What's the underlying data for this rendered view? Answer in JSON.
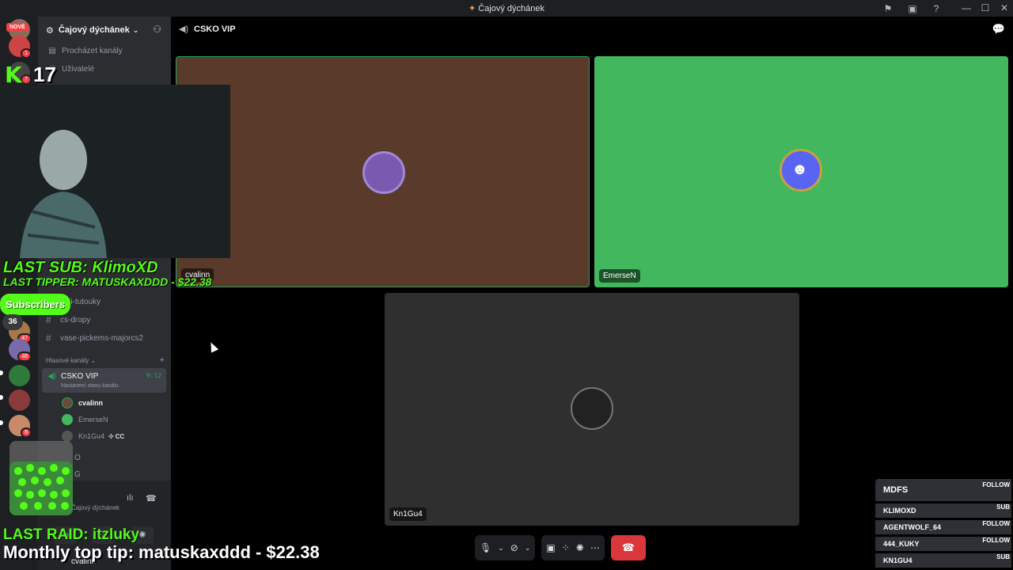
{
  "window": {
    "title": "Čajový dýchánek",
    "icons": [
      "inbox-icon",
      "screen-icon",
      "help-icon"
    ],
    "controls": [
      "—",
      "☐",
      "✕"
    ]
  },
  "rail": {
    "new_label": "NOVÉ",
    "badges": [
      "1",
      "7",
      "47",
      "48",
      "8"
    ]
  },
  "sidebar": {
    "guild_name": "Čajový dýchánek",
    "nav": [
      {
        "label": "Procházet kanály",
        "icon": "browse-icon"
      },
      {
        "label": "Uživatelé",
        "icon": "users-icon"
      }
    ],
    "channels": [
      "keti-tutouky",
      "cs-dropy",
      "vase-pickems-majorcs2"
    ],
    "voice_category": "Hlasové kanály",
    "voice_channel": {
      "name": "CSKO VIP",
      "status": "Nastavení stavu kanálu",
      "time": "9:12"
    },
    "voice_users": [
      {
        "name": "cvalinn",
        "color": "#f2f3f5"
      },
      {
        "name": "EmerseN",
        "color": "#949ba4"
      },
      {
        "name": "Kn1Gu4",
        "color": "#949ba4",
        "tag": "CC"
      }
    ],
    "partial": [
      "O",
      "G"
    ],
    "user": {
      "name": "cvalinn",
      "status": "Čajový dýchánek"
    }
  },
  "main": {
    "channel": "CSKO VIP",
    "tiles": [
      {
        "name": "cvalinn",
        "bg": "#5a3a2a"
      },
      {
        "name": "EmerseN",
        "bg": "#43b75d"
      },
      {
        "name": "Kn1Gu4",
        "bg": "#2f2f2f"
      }
    ]
  },
  "overlay": {
    "kick_count": "17",
    "last_sub": "LAST SUB: KlimoXD",
    "last_tipper": "LAST TIPPER: MATUSKAXDDD - $22.38",
    "subscribers_label": "Subscribers",
    "subscribers_count": "36",
    "last_raid": "LAST RAID: itzluky",
    "monthly_top_tip": "Monthly top tip: matuskaxddd - $22.38",
    "panel": {
      "title": "MDFS",
      "title_kind": "FOLLOW",
      "rows": [
        {
          "name": "KLIMOXD",
          "kind": "SUB"
        },
        {
          "name": "AGENTWOLF_64",
          "kind": "FOLLOW"
        },
        {
          "name": "444_KUKY",
          "kind": "FOLLOW"
        },
        {
          "name": "KN1GU4",
          "kind": "SUB"
        }
      ]
    }
  },
  "colors": {
    "kick_green": "#53fc18",
    "discord_green": "#23a55a",
    "hangup_red": "#da373c"
  }
}
